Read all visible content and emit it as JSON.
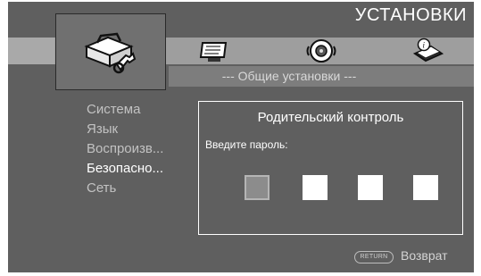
{
  "header": {
    "title": "УСТАНОВКИ"
  },
  "tabs": [
    {
      "name": "settings-tab",
      "icon": "toolbox-wrench-icon",
      "selected": true
    },
    {
      "name": "display-tab",
      "icon": "display-monitor-icon",
      "selected": false
    },
    {
      "name": "audio-tab",
      "icon": "speaker-icon",
      "selected": false
    },
    {
      "name": "info-tab",
      "icon": "info-book-icon",
      "selected": false
    }
  ],
  "section": {
    "title": "--- Общие установки ---"
  },
  "menu": {
    "items": [
      {
        "label": "Система",
        "active": false
      },
      {
        "label": "Язык",
        "active": false
      },
      {
        "label": "Воспроизв...",
        "active": false
      },
      {
        "label": "Безопасно...",
        "active": true
      },
      {
        "label": "Сеть",
        "active": false
      }
    ]
  },
  "dialog": {
    "title": "Родительский контроль",
    "password_label": "Введите пароль:",
    "pin_digits": 4,
    "current_digit": 1
  },
  "footer": {
    "return_button": "RETURN",
    "return_label": "Возврат"
  },
  "colors": {
    "background": "#5f5f5f",
    "tab_band": "#9e9e9e",
    "text_active": "#ffffff",
    "text_inactive": "#c2c2c2"
  }
}
